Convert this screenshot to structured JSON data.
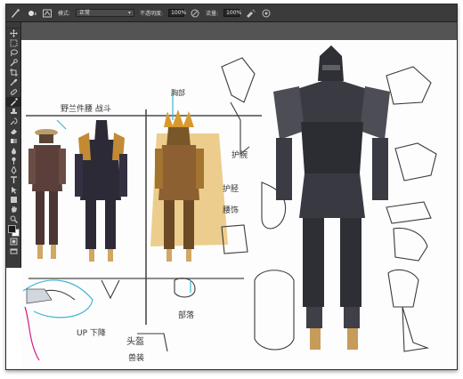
{
  "options_bar": {
    "mode_label": "模式:",
    "mode_value": "正常",
    "opacity_label": "不透明度:",
    "opacity_value": "100%",
    "flow_label": "流量:",
    "flow_value": "100%"
  },
  "canvas": {
    "notes": {
      "top_left": "野兰件腰 战斗",
      "right_1": "护腕",
      "right_2": "护胫",
      "right_3": "胸部",
      "right_4": "腰饰",
      "mid_bottom": "部落",
      "bottom_left_1": "UP 下降",
      "bottom_left_2": "头盔",
      "bottom_left_3": "兽装"
    }
  },
  "colors": {
    "ui_dark": "#3b3b3b",
    "canvas": "#fdfdfd",
    "accent_cyan": "#3fb6d4",
    "accent_magenta": "#d21a86",
    "gold": "#d8a640"
  }
}
